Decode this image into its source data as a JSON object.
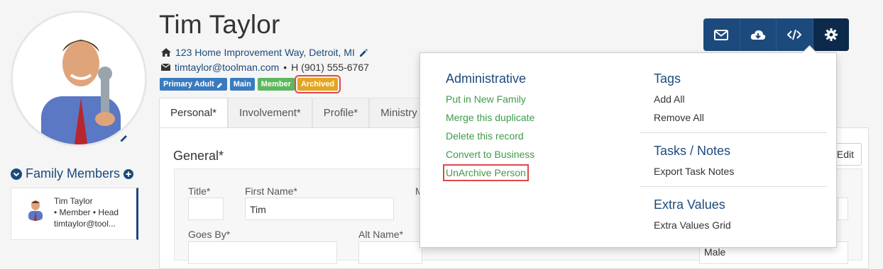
{
  "profile": {
    "name": "Tim Taylor",
    "address": "123 Home Improvement Way, Detroit, MI",
    "email": "timtaylor@toolman.com",
    "phone_sep": "•",
    "phone": "H (901) 555-6767",
    "badges": [
      "Primary Adult",
      "Main",
      "Member",
      "Archived"
    ]
  },
  "tabs": [
    "Personal*",
    "Involvement*",
    "Profile*",
    "Ministry"
  ],
  "general": {
    "title": "General*",
    "edit_label": "Edit",
    "fields": {
      "title_label": "Title*",
      "first_name_label": "First Name*",
      "first_name_value": "Tim",
      "middle_label_partial": "M",
      "goes_by_label": "Goes By*",
      "alt_name_label": "Alt Name*",
      "gender_value_partial": "Male"
    }
  },
  "family": {
    "title": "Family Members",
    "member": {
      "name": "Tim Taylor",
      "roles": "• Member • Head",
      "email": "timtaylor@tool..."
    }
  },
  "toolbar": {
    "icons": [
      "envelope-icon",
      "cloud-download-icon",
      "code-icon",
      "gear-icon"
    ]
  },
  "dropdown": {
    "administrative": {
      "heading": "Administrative",
      "items": [
        "Put in New Family",
        "Merge this duplicate",
        "Delete this record",
        "Convert to Business",
        "UnArchive Person"
      ]
    },
    "tags": {
      "heading": "Tags",
      "items": [
        "Add All",
        "Remove All"
      ]
    },
    "tasks": {
      "heading": "Tasks / Notes",
      "items": [
        "Export Task Notes"
      ]
    },
    "extra": {
      "heading": "Extra Values",
      "items": [
        "Extra Values Grid"
      ]
    }
  },
  "colors": {
    "brand": "#1c4a7c",
    "link_green": "#3f9a4a",
    "badge_blue": "#3a7bbf",
    "badge_green": "#5cb85c",
    "badge_orange": "#e4a521",
    "highlight_red": "#e0474c"
  }
}
